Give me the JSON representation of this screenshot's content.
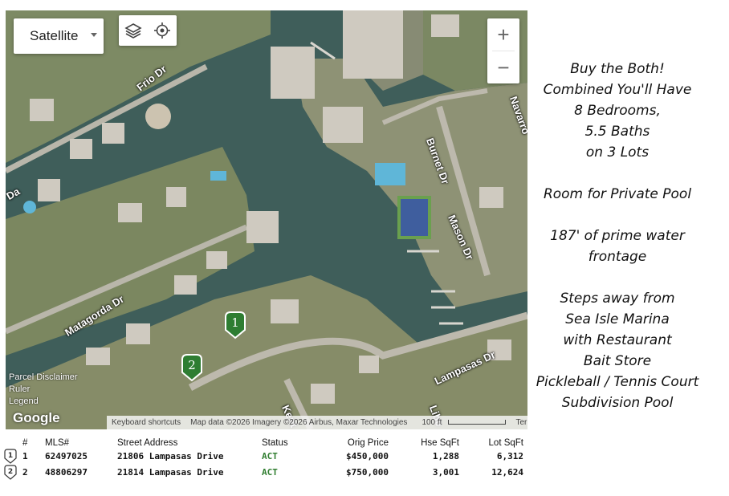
{
  "map": {
    "map_type_label": "Satellite",
    "zoom_in": "+",
    "zoom_out": "−",
    "overlay_labels": [
      "Parcel",
      "Disclaimer",
      "Ruler",
      "Legend"
    ],
    "brand": "Google",
    "attribution": {
      "shortcuts": "Keyboard shortcuts",
      "data": "Map data ©2026 Imagery ©2026 Airbus, Maxar Technologies",
      "scale": "100 ft",
      "terms": "Terms"
    },
    "streets": [
      "Frio Dr",
      "Burnet Dr",
      "Mason Dr",
      "Matagorda Dr",
      "Lampasas Dr",
      "Navarro",
      "Kent",
      "Libe",
      "Da"
    ],
    "markers": [
      {
        "label": "1",
        "color": "#2e7d32"
      },
      {
        "label": "2",
        "color": "#2e7d32"
      }
    ]
  },
  "promo": {
    "lines": [
      "Buy the Both!",
      "Combined You'll Have",
      "8 Bedrooms,",
      "5.5 Baths",
      "on 3 Lots",
      "",
      "Room for Private Pool",
      "",
      "187' of prime water",
      "frontage",
      "",
      "Steps away from",
      "Sea Isle Marina",
      "with Restaurant",
      "Bait Store",
      "Pickleball / Tennis Court",
      "Subdivision Pool"
    ]
  },
  "listing_table": {
    "headers": {
      "num": "#",
      "mls": "MLS#",
      "address": "Street Address",
      "status": "Status",
      "price": "Orig Price",
      "hse_sqft": "Hse SqFt",
      "lot_sqft": "Lot SqFt"
    },
    "rows": [
      {
        "num": "1",
        "mls": "62497025",
        "address": "21806 Lampasas Drive",
        "status": "ACT",
        "price": "$450,000",
        "hse_sqft": "1,288",
        "lot_sqft": "6,312"
      },
      {
        "num": "2",
        "mls": "48806297",
        "address": "21814 Lampasas Drive",
        "status": "ACT",
        "price": "$750,000",
        "hse_sqft": "3,001",
        "lot_sqft": "12,624"
      }
    ]
  }
}
